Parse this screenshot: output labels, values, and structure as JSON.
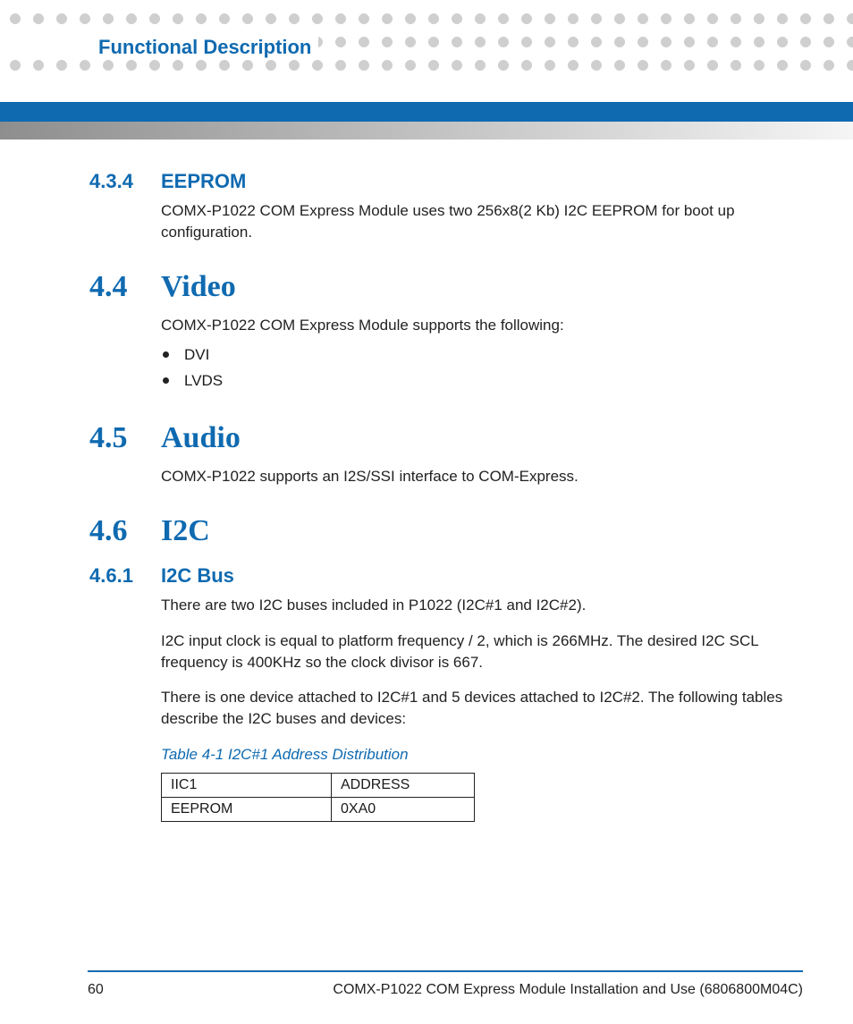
{
  "header": {
    "title": "Functional Description"
  },
  "sections": {
    "s434": {
      "num": "4.3.4",
      "title": "EEPROM",
      "para": "COMX-P1022 COM Express Module uses two 256x8(2 Kb) I2C EEPROM for boot up configuration."
    },
    "s44": {
      "num": "4.4",
      "title": "Video",
      "intro": "COMX-P1022 COM Express Module supports the following:",
      "bullets": [
        "DVI",
        "LVDS"
      ]
    },
    "s45": {
      "num": "4.5",
      "title": "Audio",
      "para": "COMX-P1022 supports an I2S/SSI interface to COM-Express."
    },
    "s46": {
      "num": "4.6",
      "title": "I2C"
    },
    "s461": {
      "num": "4.6.1",
      "title": "I2C Bus",
      "p1": "There are two I2C buses included in P1022 (I2C#1 and I2C#2).",
      "p2": "I2C input clock is equal to platform frequency / 2, which is 266MHz. The desired I2C SCL frequency is 400KHz so the clock divisor is 667.",
      "p3": "There is one device attached to I2C#1 and 5 devices attached to I2C#2. The following tables describe the I2C buses and devices:",
      "table_caption": "Table 4-1 I2C#1 Address Distribution",
      "table": {
        "h1": "IIC1",
        "h2": "ADDRESS",
        "r1c1": "EEPROM",
        "r1c2": "0XA0"
      }
    }
  },
  "footer": {
    "page": "60",
    "doc": "COMX-P1022 COM Express Module Installation and Use (6806800M04C)"
  }
}
